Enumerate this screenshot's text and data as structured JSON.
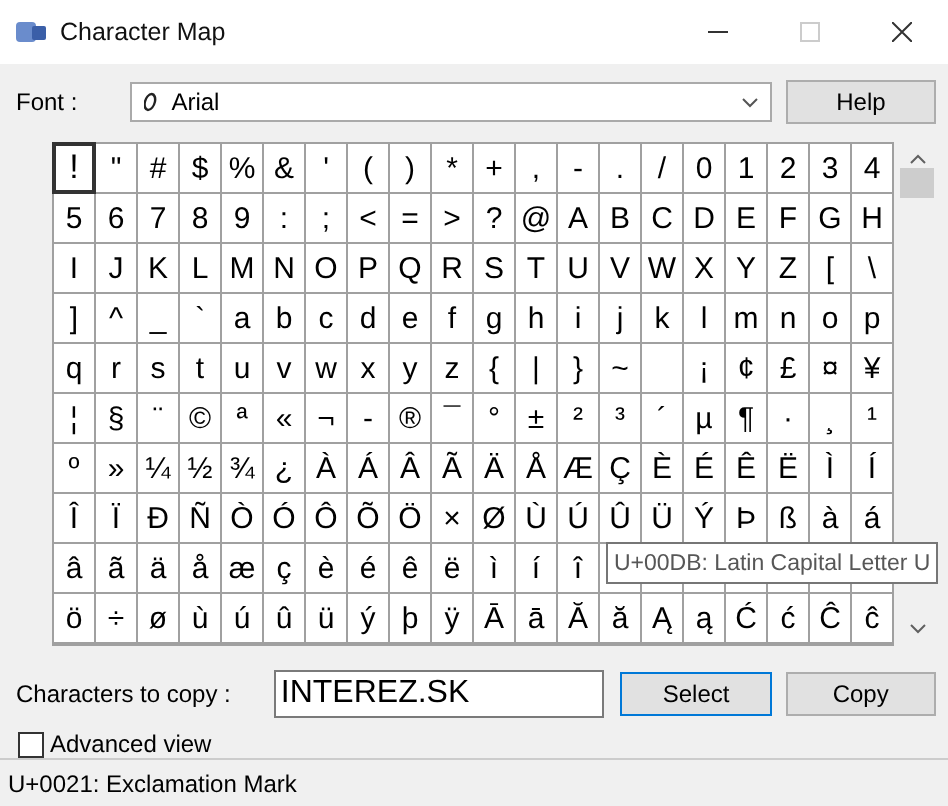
{
  "window": {
    "title": "Character Map"
  },
  "font": {
    "label": "Font :",
    "value": "Arial"
  },
  "help_button": "Help",
  "grid": {
    "rows": [
      {
        "cells": [
          {
            "char": "!",
            "selected": true
          },
          {
            "char": "\"",
            "selected": false
          },
          {
            "char": "#",
            "selected": false
          },
          {
            "char": "$",
            "selected": false
          },
          {
            "char": "%",
            "selected": false
          },
          {
            "char": "&",
            "selected": false
          },
          {
            "char": "'",
            "selected": false
          },
          {
            "char": "(",
            "selected": false
          },
          {
            "char": ")",
            "selected": false
          },
          {
            "char": "*",
            "selected": false
          },
          {
            "char": "+",
            "selected": false
          },
          {
            "char": ",",
            "selected": false
          },
          {
            "char": "-",
            "selected": false
          },
          {
            "char": ".",
            "selected": false
          },
          {
            "char": "/",
            "selected": false
          },
          {
            "char": "0",
            "selected": false
          },
          {
            "char": "1",
            "selected": false
          },
          {
            "char": "2",
            "selected": false
          },
          {
            "char": "3",
            "selected": false
          },
          {
            "char": "4",
            "selected": false
          }
        ]
      },
      {
        "cells": [
          {
            "char": "5",
            "selected": false
          },
          {
            "char": "6",
            "selected": false
          },
          {
            "char": "7",
            "selected": false
          },
          {
            "char": "8",
            "selected": false
          },
          {
            "char": "9",
            "selected": false
          },
          {
            "char": ":",
            "selected": false
          },
          {
            "char": ";",
            "selected": false
          },
          {
            "char": "<",
            "selected": false
          },
          {
            "char": "=",
            "selected": false
          },
          {
            "char": ">",
            "selected": false
          },
          {
            "char": "?",
            "selected": false
          },
          {
            "char": "@",
            "selected": false
          },
          {
            "char": "A",
            "selected": false
          },
          {
            "char": "B",
            "selected": false
          },
          {
            "char": "C",
            "selected": false
          },
          {
            "char": "D",
            "selected": false
          },
          {
            "char": "E",
            "selected": false
          },
          {
            "char": "F",
            "selected": false
          },
          {
            "char": "G",
            "selected": false
          },
          {
            "char": "H",
            "selected": false
          }
        ]
      },
      {
        "cells": [
          {
            "char": "I",
            "selected": false
          },
          {
            "char": "J",
            "selected": false
          },
          {
            "char": "K",
            "selected": false
          },
          {
            "char": "L",
            "selected": false
          },
          {
            "char": "M",
            "selected": false
          },
          {
            "char": "N",
            "selected": false
          },
          {
            "char": "O",
            "selected": false
          },
          {
            "char": "P",
            "selected": false
          },
          {
            "char": "Q",
            "selected": false
          },
          {
            "char": "R",
            "selected": false
          },
          {
            "char": "S",
            "selected": false
          },
          {
            "char": "T",
            "selected": false
          },
          {
            "char": "U",
            "selected": false
          },
          {
            "char": "V",
            "selected": false
          },
          {
            "char": "W",
            "selected": false
          },
          {
            "char": "X",
            "selected": false
          },
          {
            "char": "Y",
            "selected": false
          },
          {
            "char": "Z",
            "selected": false
          },
          {
            "char": "[",
            "selected": false
          },
          {
            "char": "\\",
            "selected": false
          }
        ]
      },
      {
        "cells": [
          {
            "char": "]",
            "selected": false
          },
          {
            "char": "^",
            "selected": false
          },
          {
            "char": "_",
            "selected": false
          },
          {
            "char": "`",
            "selected": false
          },
          {
            "char": "a",
            "selected": false
          },
          {
            "char": "b",
            "selected": false
          },
          {
            "char": "c",
            "selected": false
          },
          {
            "char": "d",
            "selected": false
          },
          {
            "char": "e",
            "selected": false
          },
          {
            "char": "f",
            "selected": false
          },
          {
            "char": "g",
            "selected": false
          },
          {
            "char": "h",
            "selected": false
          },
          {
            "char": "i",
            "selected": false
          },
          {
            "char": "j",
            "selected": false
          },
          {
            "char": "k",
            "selected": false
          },
          {
            "char": "l",
            "selected": false
          },
          {
            "char": "m",
            "selected": false
          },
          {
            "char": "n",
            "selected": false
          },
          {
            "char": "o",
            "selected": false
          },
          {
            "char": "p",
            "selected": false
          }
        ]
      },
      {
        "cells": [
          {
            "char": "q",
            "selected": false
          },
          {
            "char": "r",
            "selected": false
          },
          {
            "char": "s",
            "selected": false
          },
          {
            "char": "t",
            "selected": false
          },
          {
            "char": "u",
            "selected": false
          },
          {
            "char": "v",
            "selected": false
          },
          {
            "char": "w",
            "selected": false
          },
          {
            "char": "x",
            "selected": false
          },
          {
            "char": "y",
            "selected": false
          },
          {
            "char": "z",
            "selected": false
          },
          {
            "char": "{",
            "selected": false
          },
          {
            "char": "|",
            "selected": false
          },
          {
            "char": "}",
            "selected": false
          },
          {
            "char": "~",
            "selected": false
          },
          {
            "selected": false
          },
          {
            "char": "¡",
            "selected": false
          },
          {
            "char": "¢",
            "selected": false
          },
          {
            "char": "£",
            "selected": false
          },
          {
            "char": "¤",
            "selected": false
          },
          {
            "char": "¥",
            "selected": false
          }
        ]
      },
      {
        "cells": [
          {
            "char": "¦",
            "selected": false
          },
          {
            "char": "§",
            "selected": false
          },
          {
            "char": "¨",
            "selected": false
          },
          {
            "char": "©",
            "selected": false
          },
          {
            "char": "ª",
            "selected": false
          },
          {
            "char": "«",
            "selected": false
          },
          {
            "char": "¬",
            "selected": false
          },
          {
            "char": "-",
            "selected": false
          },
          {
            "char": "®",
            "selected": false
          },
          {
            "char": "¯",
            "selected": false
          },
          {
            "char": "°",
            "selected": false
          },
          {
            "char": "±",
            "selected": false
          },
          {
            "char": "²",
            "selected": false
          },
          {
            "char": "³",
            "selected": false
          },
          {
            "char": "´",
            "selected": false
          },
          {
            "char": "µ",
            "selected": false
          },
          {
            "char": "¶",
            "selected": false
          },
          {
            "char": "·",
            "selected": false
          },
          {
            "char": "¸",
            "selected": false
          },
          {
            "char": "¹",
            "selected": false
          }
        ]
      },
      {
        "cells": [
          {
            "char": "º",
            "selected": false
          },
          {
            "char": "»",
            "selected": false
          },
          {
            "char": "¼",
            "selected": false
          },
          {
            "char": "½",
            "selected": false
          },
          {
            "char": "¾",
            "selected": false
          },
          {
            "char": "¿",
            "selected": false
          },
          {
            "char": "À",
            "selected": false
          },
          {
            "char": "Á",
            "selected": false
          },
          {
            "char": "Â",
            "selected": false
          },
          {
            "char": "Ã",
            "selected": false
          },
          {
            "char": "Ä",
            "selected": false
          },
          {
            "char": "Å",
            "selected": false
          },
          {
            "char": "Æ",
            "selected": false
          },
          {
            "char": "Ç",
            "selected": false
          },
          {
            "char": "È",
            "selected": false
          },
          {
            "char": "É",
            "selected": false
          },
          {
            "char": "Ê",
            "selected": false
          },
          {
            "char": "Ë",
            "selected": false
          },
          {
            "char": "Ì",
            "selected": false
          },
          {
            "char": "Í",
            "selected": false
          }
        ]
      },
      {
        "cells": [
          {
            "char": "Î",
            "selected": false
          },
          {
            "char": "Ï",
            "selected": false
          },
          {
            "char": "Ð",
            "selected": false
          },
          {
            "char": "Ñ",
            "selected": false
          },
          {
            "char": "Ò",
            "selected": false
          },
          {
            "char": "Ó",
            "selected": false
          },
          {
            "char": "Ô",
            "selected": false
          },
          {
            "char": "Õ",
            "selected": false
          },
          {
            "char": "Ö",
            "selected": false
          },
          {
            "char": "×",
            "selected": false
          },
          {
            "char": "Ø",
            "selected": false
          },
          {
            "char": "Ù",
            "selected": false
          },
          {
            "char": "Ú",
            "selected": false
          },
          {
            "char": "Û",
            "selected": false
          },
          {
            "char": "Ü",
            "selected": false
          },
          {
            "char": "Ý",
            "selected": false
          },
          {
            "char": "Þ",
            "selected": false
          },
          {
            "char": "ß",
            "selected": false
          },
          {
            "char": "à",
            "selected": false
          },
          {
            "char": "á",
            "selected": false
          }
        ]
      },
      {
        "cells": [
          {
            "char": "â",
            "selected": false
          },
          {
            "char": "ã",
            "selected": false
          },
          {
            "char": "ä",
            "selected": false
          },
          {
            "char": "å",
            "selected": false
          },
          {
            "char": "æ",
            "selected": false
          },
          {
            "char": "ç",
            "selected": false
          },
          {
            "char": "è",
            "selected": false
          },
          {
            "char": "é",
            "selected": false
          },
          {
            "char": "ê",
            "selected": false
          },
          {
            "char": "ë",
            "selected": false
          },
          {
            "char": "ì",
            "selected": false
          },
          {
            "char": "í",
            "selected": false
          },
          {
            "char": "î",
            "selected": false
          },
          {
            "selected": false
          },
          {
            "selected": false
          },
          {
            "selected": false
          },
          {
            "selected": false
          },
          {
            "selected": false
          },
          {
            "selected": false
          },
          {
            "selected": false
          }
        ]
      },
      {
        "cells": [
          {
            "char": "ö",
            "selected": false
          },
          {
            "char": "÷",
            "selected": false
          },
          {
            "char": "ø",
            "selected": false
          },
          {
            "char": "ù",
            "selected": false
          },
          {
            "char": "ú",
            "selected": false
          },
          {
            "char": "û",
            "selected": false
          },
          {
            "char": "ü",
            "selected": false
          },
          {
            "char": "ý",
            "selected": false
          },
          {
            "char": "þ",
            "selected": false
          },
          {
            "char": "ÿ",
            "selected": false
          },
          {
            "char": "Ā",
            "selected": false
          },
          {
            "char": "ā",
            "selected": false
          },
          {
            "char": "Ă",
            "selected": false
          },
          {
            "char": "ă",
            "selected": false
          },
          {
            "char": "Ą",
            "selected": false
          },
          {
            "char": "ą",
            "selected": false
          },
          {
            "char": "Ć",
            "selected": false
          },
          {
            "char": "ć",
            "selected": false
          },
          {
            "char": "Ĉ",
            "selected": false
          },
          {
            "char": "ĉ",
            "selected": false
          }
        ]
      }
    ]
  },
  "tooltip": "U+00DB: Latin Capital Letter U",
  "copy": {
    "label": "Characters to copy :",
    "value": "INTEREZ.SK"
  },
  "select_button": "Select",
  "copy_button": "Copy",
  "advanced_view": {
    "label": "Advanced view",
    "checked": false
  },
  "status_bar": "U+0021: Exclamation Mark"
}
